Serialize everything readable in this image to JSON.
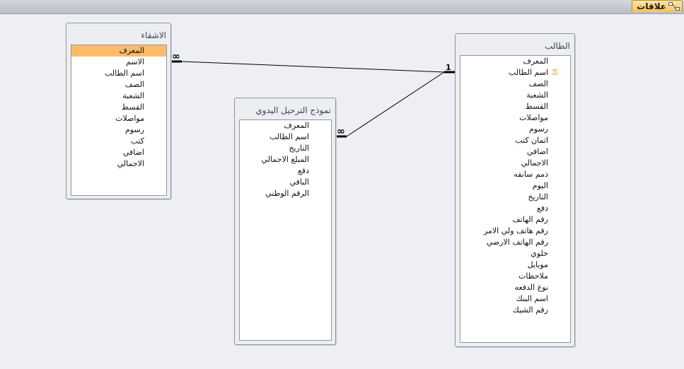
{
  "tab": {
    "label": "علاقات",
    "icon": "relationships-icon"
  },
  "tables": {
    "ashqaa": {
      "title": "الاشقاء",
      "fields": [
        "المعرف",
        "الاسم",
        "اسم الطالب",
        "الصف",
        "الشعبة",
        "القسط",
        "مواصلات",
        "رسوم",
        "كتب",
        "اضافي",
        "الاجمالي"
      ],
      "selected_field": "المعرف"
    },
    "transfer": {
      "title": "نموذج الترحيل اليدوي",
      "fields": [
        "المعرف",
        "اسم الطالب",
        "التاريخ",
        "المبلغ الاجمالي",
        "دفع",
        "الباقي",
        "الرقم الوطني"
      ]
    },
    "student": {
      "title": "الطالب",
      "fields": [
        "المعرف",
        "اسم الطالب",
        "الصف",
        "الشعبة",
        "القسط",
        "مواصلات",
        "رسوم",
        "اثمان كتب",
        "اضافي",
        "الاجمالي",
        "ذمم سابقه",
        "اليوم",
        "التاريخ",
        "دفع",
        "رقم الهاتف",
        "رقم هاتف ولي الامر",
        "رقم الهاتف الارضي",
        "خلوي",
        "موبايل",
        "ملاحظات",
        "نوع الدفعه",
        "اسم البنك",
        "رقم الشيك"
      ],
      "key_field": "اسم الطالب",
      "key_icon": "primary-key-icon"
    }
  },
  "relationships": [
    {
      "from": "ashqaa",
      "to": "student",
      "many_label": "∞",
      "one_label": "1"
    },
    {
      "from": "transfer",
      "to": "student",
      "many_label": "∞",
      "one_label": ""
    }
  ]
}
